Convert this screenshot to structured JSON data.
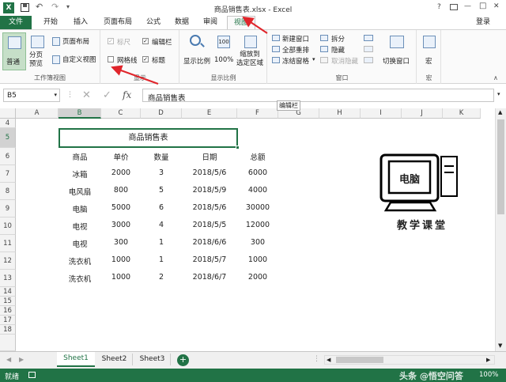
{
  "window": {
    "title": "商品销售表.xlsx - Excel",
    "help": "?",
    "login": "登录",
    "min": "—",
    "max": "□",
    "close": "✕"
  },
  "quick_access": {
    "save_icon": "save-icon",
    "undo_icon": "undo-icon",
    "redo_icon": "redo-icon"
  },
  "tabs": [
    {
      "label": "文件"
    },
    {
      "label": "开始"
    },
    {
      "label": "插入"
    },
    {
      "label": "页面布局"
    },
    {
      "label": "公式"
    },
    {
      "label": "数据"
    },
    {
      "label": "审阅"
    },
    {
      "label": "视图"
    }
  ],
  "ribbon": {
    "workbook_views": {
      "label": "工作簿视图",
      "normal": "普通",
      "page_break": "分页\n预览",
      "page_layout": "页面布局",
      "custom_view": "自定义视图"
    },
    "show": {
      "label": "显示",
      "ruler": "标尺",
      "formula_bar": "编辑栏",
      "gridlines": "网格线",
      "headings": "标题",
      "ruler_checked": true,
      "formula_bar_checked": true,
      "gridlines_checked": false,
      "headings_checked": true
    },
    "zoom": {
      "label": "显示比例",
      "zoom": "显示比例",
      "hundred": "100%",
      "zoom_selection": "缩放到\n选定区域"
    },
    "window": {
      "label": "窗口",
      "new_window": "新建窗口",
      "arrange_all": "全部重排",
      "freeze": "冻结窗格",
      "split": "拆分",
      "hide": "隐藏",
      "unhide": "取消隐藏",
      "switch": "切换窗口"
    },
    "macros": {
      "label": "宏",
      "macro": "宏"
    }
  },
  "formula_bar": {
    "name_box": "B5",
    "fx": "fx",
    "value": "商品销售表",
    "tooltip": "编辑栏"
  },
  "columns": [
    "A",
    "B",
    "C",
    "D",
    "E",
    "F",
    "G",
    "H",
    "I",
    "J",
    "K"
  ],
  "rows": [
    "4",
    "5",
    "6",
    "7",
    "8",
    "9",
    "10",
    "11",
    "12",
    "13",
    "14",
    "15",
    "16",
    "17",
    "18"
  ],
  "table": {
    "title": "商品销售表",
    "headers": [
      "商品",
      "单价",
      "数量",
      "日期",
      "总额"
    ],
    "rows": [
      [
        "冰箱",
        "2000",
        "3",
        "2018/5/6",
        "6000"
      ],
      [
        "电风扇",
        "800",
        "5",
        "2018/5/9",
        "4000"
      ],
      [
        "电脑",
        "5000",
        "6",
        "2018/5/6",
        "30000"
      ],
      [
        "电视",
        "3000",
        "4",
        "2018/5/5",
        "12000"
      ],
      [
        "电视",
        "300",
        "1",
        "2018/6/6",
        "300"
      ],
      [
        "洗衣机",
        "1000",
        "1",
        "2018/5/7",
        "1000"
      ],
      [
        "洗衣机",
        "1000",
        "2",
        "2018/6/7",
        "2000"
      ]
    ]
  },
  "logo": {
    "screen_text": "电脑",
    "caption": "教学课堂"
  },
  "sheets": [
    {
      "name": "Sheet1"
    },
    {
      "name": "Sheet2"
    },
    {
      "name": "Sheet3"
    }
  ],
  "status": {
    "ready": "就绪",
    "zoom": "100%",
    "watermark": "头条 @悟空问答"
  },
  "colors": {
    "excel_green": "#217346",
    "arrow_red": "#e0252b",
    "selected_border": "#217346"
  }
}
